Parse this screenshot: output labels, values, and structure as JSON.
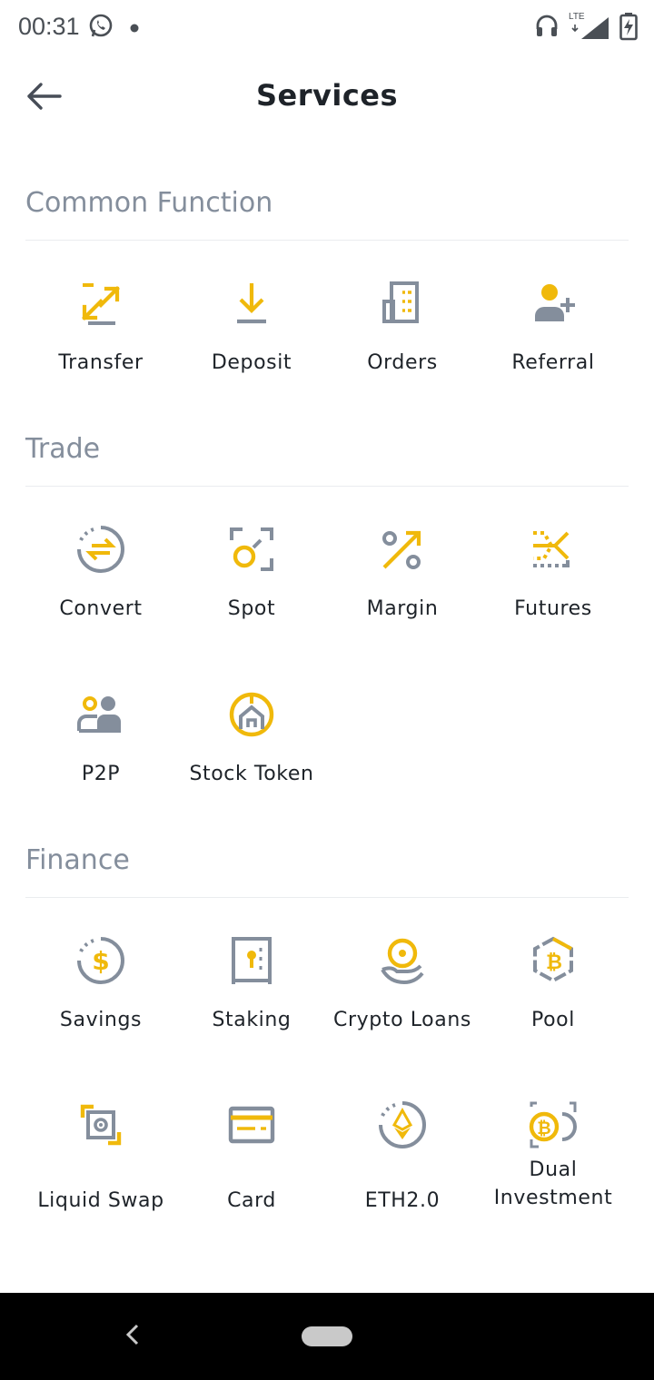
{
  "status_bar": {
    "time": "00:31",
    "network_label": "LTE",
    "icons": [
      "whatsapp-icon",
      "notification-dot-icon",
      "headset-icon",
      "signal-icon",
      "battery-charging-icon"
    ]
  },
  "header": {
    "title": "Services",
    "back_icon": "arrow-left-icon"
  },
  "colors": {
    "accent": "#f0b90b",
    "icon_gray": "#848e9c",
    "text": "#1e2329",
    "section_title": "#848e9c",
    "divider": "#eaecef"
  },
  "sections": {
    "common": {
      "title": "Common Function",
      "items": [
        {
          "label": "Transfer",
          "icon": "transfer-icon"
        },
        {
          "label": "Deposit",
          "icon": "deposit-icon"
        },
        {
          "label": "Orders",
          "icon": "orders-icon"
        },
        {
          "label": "Referral",
          "icon": "referral-icon"
        }
      ]
    },
    "trade": {
      "title": "Trade",
      "items": [
        {
          "label": "Convert",
          "icon": "convert-icon"
        },
        {
          "label": "Spot",
          "icon": "spot-icon"
        },
        {
          "label": "Margin",
          "icon": "margin-icon"
        },
        {
          "label": "Futures",
          "icon": "futures-icon"
        },
        {
          "label": "P2P",
          "icon": "p2p-icon"
        },
        {
          "label": "Stock Token",
          "icon": "stock-token-icon"
        }
      ]
    },
    "finance": {
      "title": "Finance",
      "items": [
        {
          "label": "Savings",
          "icon": "savings-icon"
        },
        {
          "label": "Staking",
          "icon": "staking-icon"
        },
        {
          "label": "Crypto Loans",
          "icon": "crypto-loans-icon"
        },
        {
          "label": "Pool",
          "icon": "pool-icon"
        },
        {
          "label": "Liquid Swap",
          "icon": "liquid-swap-icon"
        },
        {
          "label": "Card",
          "icon": "card-icon"
        },
        {
          "label": "ETH2.0",
          "icon": "eth2-icon"
        },
        {
          "label": "Dual\nInvestment",
          "icon": "dual-investment-icon"
        }
      ]
    }
  },
  "nav_bar": {
    "icons": [
      "nav-back-icon",
      "nav-home-pill-icon"
    ]
  }
}
